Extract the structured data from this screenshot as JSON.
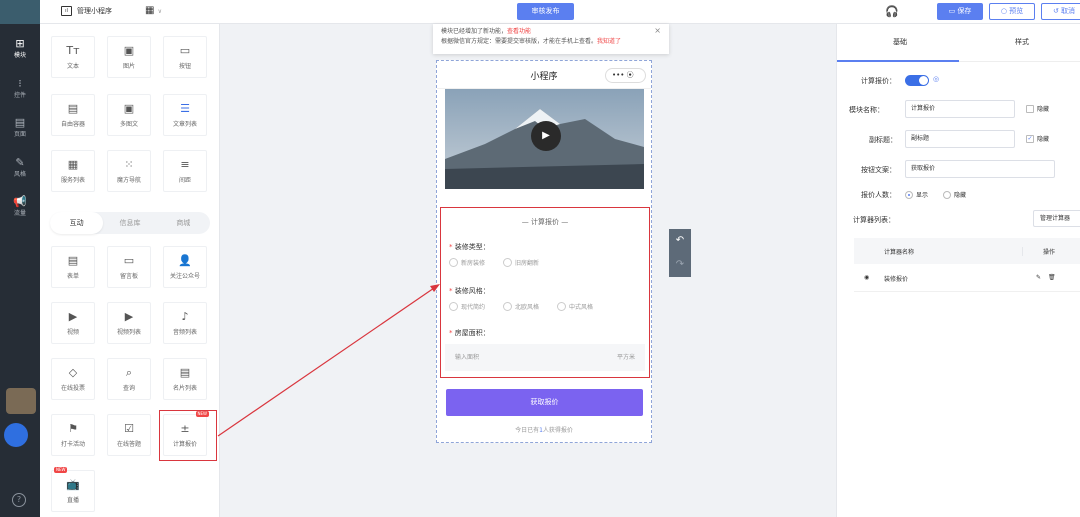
{
  "topbar": {
    "app_name": "管理小程序",
    "app_name_icon": "mini-program-icon",
    "publish_label": "审核发布",
    "save_label": "保存",
    "preview_label": "预览",
    "cancel_label": "取消"
  },
  "leftnav": [
    {
      "icon": "add-block-icon",
      "label": "模块",
      "active": true
    },
    {
      "icon": "control-icon",
      "label": "控件"
    },
    {
      "icon": "page-icon",
      "label": "页面"
    },
    {
      "icon": "style-icon",
      "label": "风格"
    },
    {
      "icon": "promotion-icon",
      "label": "流量"
    }
  ],
  "palette": {
    "row1": [
      {
        "icon": "text-icon",
        "label": "文本"
      },
      {
        "icon": "image-icon",
        "label": "图片"
      },
      {
        "icon": "button-icon",
        "label": "按钮"
      }
    ],
    "row2": [
      {
        "icon": "container-icon",
        "label": "自由容器"
      },
      {
        "icon": "image-text-icon",
        "label": "多图文"
      },
      {
        "icon": "article-list-icon",
        "label": "文章列表"
      }
    ],
    "row3": [
      {
        "icon": "service-list-icon",
        "label": "服务列表"
      },
      {
        "icon": "grid-nav-icon",
        "label": "魔方导航"
      },
      {
        "icon": "divider-icon",
        "label": "间距"
      }
    ],
    "tabs": [
      "互动",
      "信息库",
      "商城"
    ],
    "row4": [
      {
        "icon": "form-icon",
        "label": "表单"
      },
      {
        "icon": "message-icon",
        "label": "留言板"
      },
      {
        "icon": "follow-icon",
        "label": "关注公众号"
      }
    ],
    "row5": [
      {
        "icon": "video-icon",
        "label": "视频"
      },
      {
        "icon": "video-list-icon",
        "label": "视频列表"
      },
      {
        "icon": "audio-list-icon",
        "label": "音频列表"
      }
    ],
    "row6": [
      {
        "icon": "vote-icon",
        "label": "在线投票"
      },
      {
        "icon": "query-icon",
        "label": "查询"
      },
      {
        "icon": "card-list-icon",
        "label": "名片列表"
      }
    ],
    "row7": [
      {
        "icon": "checkin-icon",
        "label": "打卡活动"
      },
      {
        "icon": "quiz-icon",
        "label": "在线答题"
      },
      {
        "icon": "calculator-icon",
        "label": "计算报价",
        "hot": "NEW"
      }
    ],
    "row8": [
      {
        "icon": "live-icon",
        "label": "直播",
        "hot": "NEW"
      }
    ]
  },
  "notice": {
    "line1_prefix": "模块已经增加了新功能，",
    "line1_link": "查看功能",
    "line2_prefix": "根据微信官方规定：需要提交审核版，才能在手机上查看。",
    "line2_link": "我知道了"
  },
  "phone": {
    "title": "小程序",
    "capsule_dots": "•••",
    "capsule_target": "⦿",
    "calc_title": "— 计算报价 —",
    "field1_label": "装修类型：",
    "field1_opts": [
      "新房装修",
      "旧房翻新"
    ],
    "field2_label": "装修风格：",
    "field2_opts": [
      "现代简约",
      "北欧风格",
      "中式风格"
    ],
    "field3_label": "房屋面积：",
    "area_placeholder": "输入面积",
    "area_unit": "平方米",
    "submit_label": "获取报价",
    "footer_prefix": "今日已有",
    "footer_count": "1",
    "footer_suffix": "人获得报价"
  },
  "props": {
    "tab_basic": "基础",
    "tab_style": "样式",
    "calc_toggle_label": "计算报价：",
    "module_name_label": "模块名称：",
    "module_name_value": "计算报价",
    "hide_label": "隐藏",
    "subtitle_label": "副标题：",
    "subtitle_value": "副标题",
    "hide_label2": "隐藏",
    "button_text_label": "按钮文案：",
    "button_text_value": "获取报价",
    "count_label": "报价人数：",
    "count_show": "显示",
    "count_hide": "隐藏",
    "calc_list_label": "计算器列表：",
    "manage_btn": "管理计算器",
    "table_col1": "计算器名称",
    "table_col2": "操作",
    "table_row1": "装修报价"
  },
  "colors": {
    "accent": "#5b7ff0",
    "highlight": "#d9363e",
    "submit": "#7b63f0"
  }
}
